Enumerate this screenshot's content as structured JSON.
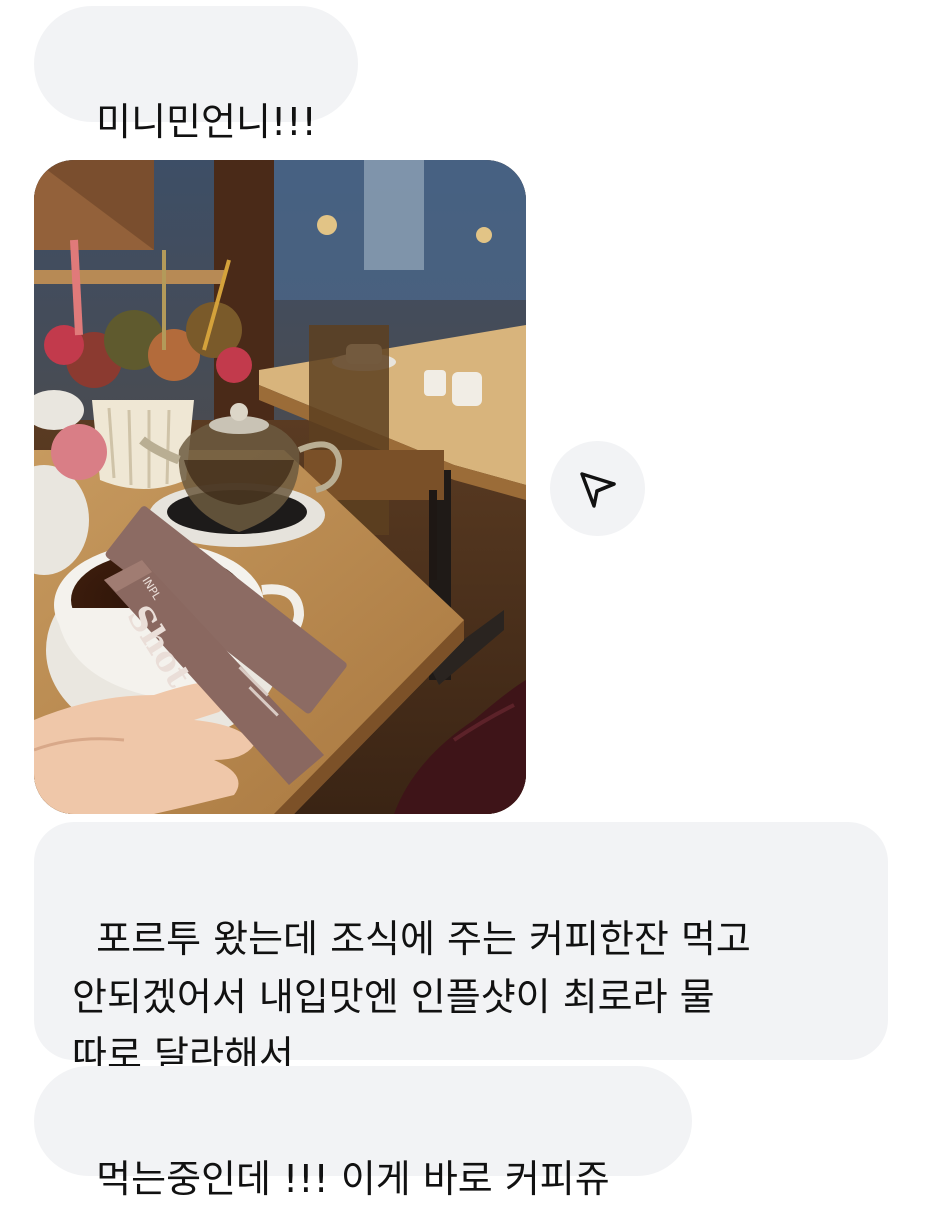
{
  "messages": [
    {
      "type": "text",
      "text": "미니민언니!!!"
    },
    {
      "type": "image",
      "icon": "photo-cafe-coffee-image",
      "packet_brand": "Shot",
      "packet_brand_prefix": "INPL"
    },
    {
      "type": "text",
      "text": "포르투 왔는데 조식에 주는 커피한잔 먹고\n안되겠어서 내입맛엔 인플샷이 최로라 물\n따로 달라해서"
    },
    {
      "type": "text",
      "text": "먹는중인데 !!! 이게 바로 커피쥬"
    }
  ],
  "share_button": {
    "icon": "paper-plane-share-icon"
  },
  "colors": {
    "bubble_bg": "#f2f3f5",
    "text": "#111111",
    "page_bg": "#ffffff"
  }
}
